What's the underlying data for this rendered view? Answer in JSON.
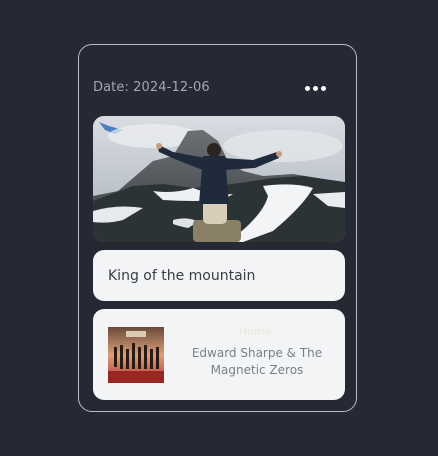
{
  "post": {
    "date_label": "Date: 2024-12-06",
    "caption": "King of the mountain",
    "menu_icon": "more-horizontal-icon"
  },
  "music": {
    "song_title": "Home",
    "artist": "Edward Sharpe & The Magnetic Zeros"
  },
  "colors": {
    "background": "#262833",
    "card_border": "#b9bcc6",
    "panel": "#f3f4f6",
    "date_text": "#a3a7b3"
  }
}
